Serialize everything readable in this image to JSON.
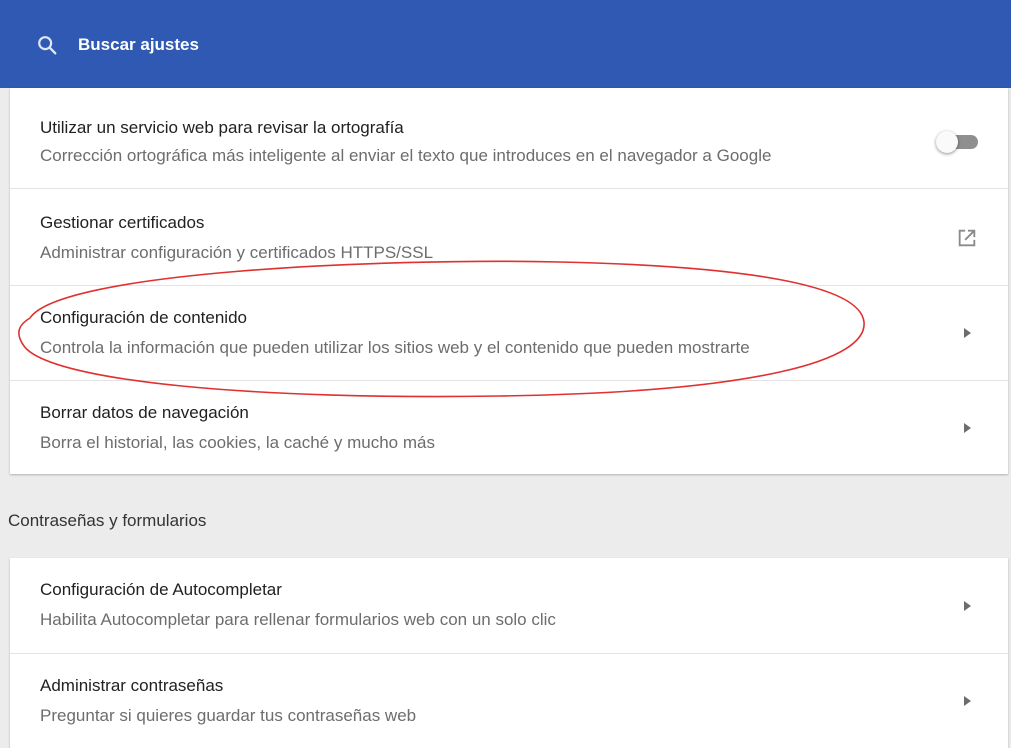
{
  "search": {
    "placeholder": "Buscar ajustes",
    "icon": "search-icon"
  },
  "settings_card": {
    "rows": [
      {
        "title": "Utilizar un servicio web para revisar la ortografía",
        "subtitle": "Corrección ortográfica más inteligente al enviar el texto que introduces en el navegador a Google",
        "control": "toggle",
        "toggle_on": false
      },
      {
        "title": "Gestionar certificados",
        "subtitle": "Administrar configuración y certificados HTTPS/SSL",
        "control": "open-in-new-icon"
      },
      {
        "title": "Configuración de contenido",
        "subtitle": "Controla la información que pueden utilizar los sitios web y el contenido que pueden mostrarte",
        "control": "chevron-right-icon"
      },
      {
        "title": "Borrar datos de navegación",
        "subtitle": "Borra el historial, las cookies, la caché y mucho más",
        "control": "chevron-right-icon"
      }
    ]
  },
  "passwords_section": {
    "header": "Contraseñas y formularios",
    "rows": [
      {
        "title": "Configuración de Autocompletar",
        "subtitle": "Habilita Autocompletar para rellenar formularios web con un solo clic",
        "control": "chevron-right-icon"
      },
      {
        "title": "Administrar contraseñas",
        "subtitle": "Preguntar si quieres guardar tus contraseñas web",
        "control": "chevron-right-icon"
      }
    ]
  },
  "colors": {
    "header_blue": "#2f59b3",
    "annotation_red": "#e03030"
  }
}
